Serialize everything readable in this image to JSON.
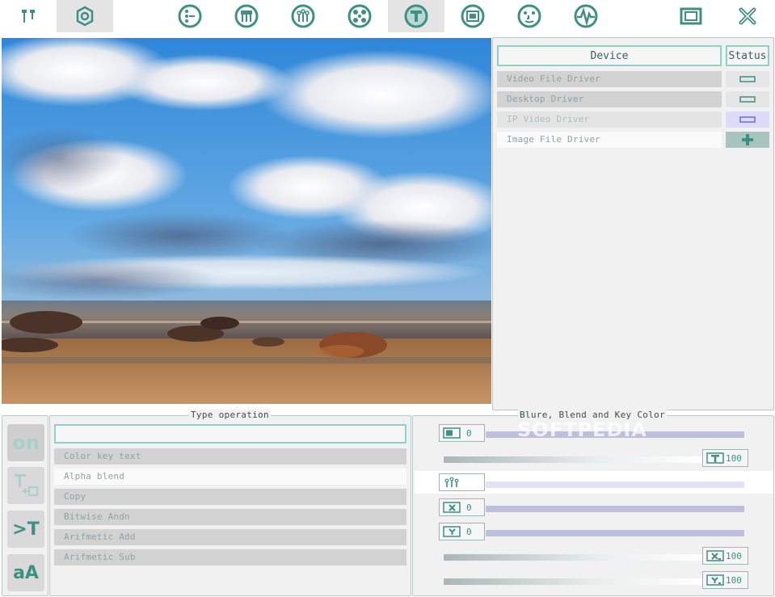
{
  "toolbar": {
    "buttons": [
      {
        "name": "tools-icon",
        "active": false
      },
      {
        "name": "settings-icon",
        "active": true
      },
      {
        "name": "source-icon",
        "active": false
      },
      {
        "name": "blend-icon",
        "active": false
      },
      {
        "name": "filter-icon",
        "active": false
      },
      {
        "name": "effects-icon",
        "active": false
      },
      {
        "name": "text-icon",
        "active": true
      },
      {
        "name": "window-icon",
        "active": false
      },
      {
        "name": "face-icon",
        "active": false
      },
      {
        "name": "waveform-icon",
        "active": false
      },
      {
        "name": "fullscreen-icon",
        "active": false
      },
      {
        "name": "close-icon",
        "active": false
      }
    ]
  },
  "devices": {
    "header_device": "Device",
    "header_status": "Status",
    "rows": [
      {
        "label": "Video File Driver",
        "status": "minus"
      },
      {
        "label": "Desktop Driver",
        "status": "minus"
      },
      {
        "label": "IP Video Driver",
        "status": "minus-active"
      },
      {
        "label": "Image File Driver",
        "status": "plus"
      }
    ]
  },
  "left_tools": {
    "on_label": "on",
    "text_in_label": ">T",
    "font_label": "aA"
  },
  "type_operation": {
    "title": "Type operation",
    "input_value": "",
    "operations": [
      "Color key text",
      "Alpha blend",
      "Copy",
      "Bitwise Andn",
      "Arifmetic Add",
      "Arifmetic Sub"
    ]
  },
  "blend": {
    "title": "Blure, Blend and Key Color",
    "controls": [
      {
        "icon": "blur-icon",
        "value": "0",
        "level": 0
      },
      {
        "icon": "text-alpha-icon",
        "value": "100",
        "level": 1
      },
      {
        "icon": "levels-icon",
        "value": "",
        "level": 0
      },
      {
        "icon": "x-offset-icon",
        "value": "0",
        "level": 0
      },
      {
        "icon": "y-offset-icon",
        "value": "0",
        "level": 0
      },
      {
        "icon": "x-scale-icon",
        "value": "100",
        "level": 1
      },
      {
        "icon": "y-scale-icon",
        "value": "100",
        "level": 1
      }
    ]
  },
  "watermark": "SOFTPEDIA",
  "colors": {
    "accent": "#3f8f83",
    "accent_light": "#8ed1c8",
    "panel_bg": "#f1f1f1",
    "row_bg": "#d2d2d2",
    "slider_purple": "#bebedd"
  }
}
